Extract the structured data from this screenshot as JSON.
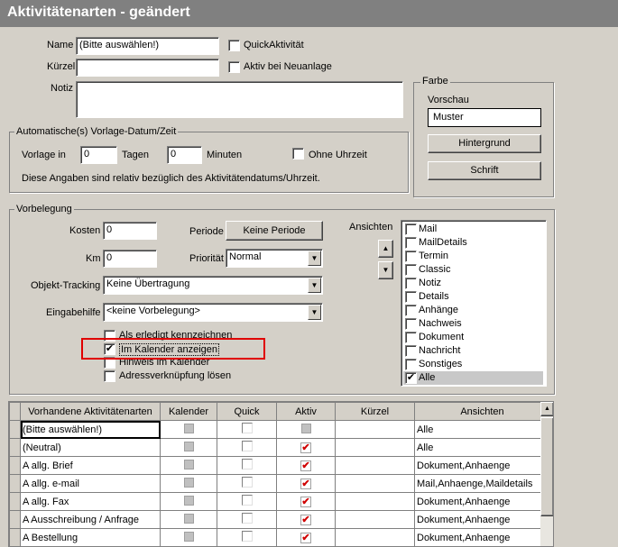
{
  "window": {
    "title": "Aktivitätenarten - geändert"
  },
  "form": {
    "name_label": "Name",
    "name_value": "(Bitte auswählen!)",
    "kuerzel_label": "Kürzel",
    "kuerzel_value": "",
    "notiz_label": "Notiz",
    "quick_label": "QuickAktivität",
    "aktiv_label": "Aktiv bei Neuanlage"
  },
  "farbe": {
    "legend": "Farbe",
    "vorschau_label": "Vorschau",
    "preview_text": "Muster",
    "hintergrund_button": "Hintergrund",
    "schrift_button": "Schrift"
  },
  "auto": {
    "legend": "Automatische(s) Vorlage-Datum/Zeit",
    "vorlage_label": "Vorlage in",
    "tage_value": "0",
    "tage_label": "Tagen",
    "minuten_value": "0",
    "minuten_label": "Minuten",
    "ohne_uhrzeit_label": "Ohne Uhrzeit",
    "hint": "Diese Angaben sind relativ bezüglich des Aktivitätendatums/Uhrzeit."
  },
  "vorbelegung": {
    "legend": "Vorbelegung",
    "kosten_label": "Kosten",
    "kosten_value": "0",
    "km_label": "Km",
    "km_value": "0",
    "periode_label": "Periode",
    "periode_button": "Keine Periode",
    "prioritaet_label": "Priorität",
    "prioritaet_value": "Normal",
    "objekt_label": "Objekt-Tracking",
    "objekt_value": "Keine Übertragung",
    "eingabe_label": "Eingabehilfe",
    "eingabe_value": "<keine Vorbelegung>",
    "options": [
      {
        "label": "Als erledigt kennzeichnen",
        "checked": false
      },
      {
        "label": "Im Kalender anzeigen",
        "checked": true
      },
      {
        "label": "Hinweis im Kalender",
        "checked": false
      },
      {
        "label": "Adressverknüpfung lösen",
        "checked": false
      }
    ],
    "ansichten_label": "Ansichten",
    "ansichten": [
      {
        "label": "Mail",
        "checked": false
      },
      {
        "label": "MailDetails",
        "checked": false
      },
      {
        "label": "Termin",
        "checked": false
      },
      {
        "label": "Classic",
        "checked": false
      },
      {
        "label": "Notiz",
        "checked": false
      },
      {
        "label": "Details",
        "checked": false
      },
      {
        "label": "Anhänge",
        "checked": false
      },
      {
        "label": "Nachweis",
        "checked": false
      },
      {
        "label": "Dokument",
        "checked": false
      },
      {
        "label": "Nachricht",
        "checked": false
      },
      {
        "label": "Sonstiges",
        "checked": false
      },
      {
        "label": "Alle",
        "checked": true
      }
    ]
  },
  "table": {
    "columns": [
      "Vorhandene Aktivitätenarten",
      "Kalender",
      "Quick",
      "Aktiv",
      "Kürzel",
      "Ansichten"
    ],
    "rows": [
      {
        "name": "(Bitte auswählen!)",
        "aktiv": false,
        "kuerzel": "",
        "ansichten": "Alle"
      },
      {
        "name": "(Neutral)",
        "aktiv": true,
        "kuerzel": "",
        "ansichten": "Alle"
      },
      {
        "name": "A allg. Brief",
        "aktiv": true,
        "kuerzel": "",
        "ansichten": "Dokument,Anhaenge"
      },
      {
        "name": "A allg. e-mail",
        "aktiv": true,
        "kuerzel": "",
        "ansichten": "Mail,Anhaenge,Maildetails"
      },
      {
        "name": "A allg. Fax",
        "aktiv": true,
        "kuerzel": "",
        "ansichten": "Dokument,Anhaenge"
      },
      {
        "name": "A Ausschreibung / Anfrage",
        "aktiv": true,
        "kuerzel": "",
        "ansichten": "Dokument,Anhaenge"
      },
      {
        "name": "A Bestellung",
        "aktiv": true,
        "kuerzel": "",
        "ansichten": "Dokument,Anhaenge"
      }
    ]
  },
  "colors": {
    "highlight_box": "#e00000",
    "title_bg": "#808080",
    "check_red": "#d00000"
  }
}
